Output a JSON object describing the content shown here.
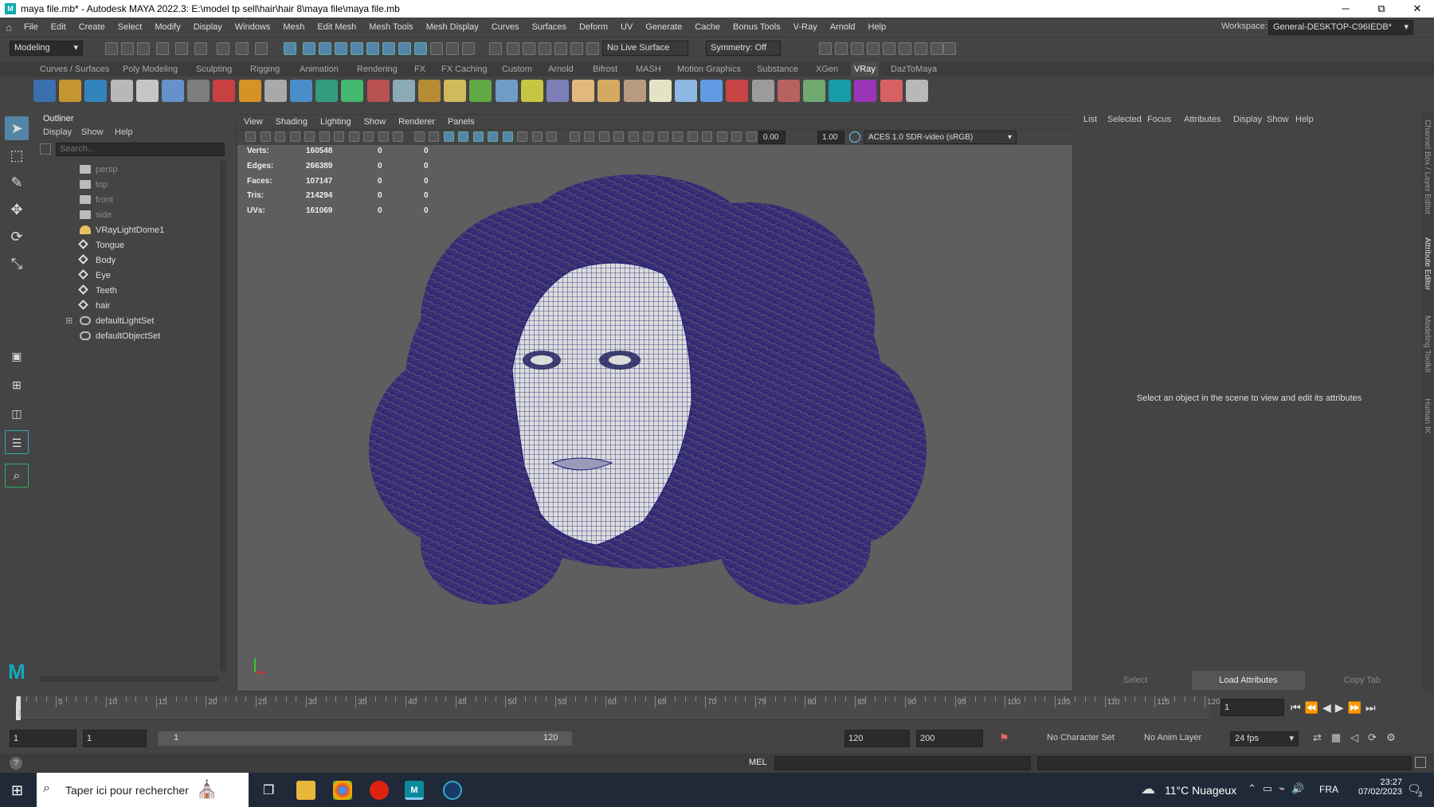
{
  "titlebar": {
    "title": "maya file.mb* - Autodesk MAYA 2022.3: E:\\model tp sell\\hair\\hair 8\\maya file\\maya file.mb",
    "minimize": "─",
    "maximize": "⧉",
    "close": "✕"
  },
  "menubar": {
    "items": [
      "File",
      "Edit",
      "Create",
      "Select",
      "Modify",
      "Display",
      "Windows",
      "Mesh",
      "Edit Mesh",
      "Mesh Tools",
      "Mesh Display",
      "Curves",
      "Surfaces",
      "Deform",
      "UV",
      "Generate",
      "Cache",
      "Bonus Tools",
      "V-Ray",
      "Arnold",
      "Help"
    ],
    "workspace_label": "Workspace:",
    "workspace_value": "General-DESKTOP-C96IEDB*"
  },
  "statusline": {
    "mode": "Modeling",
    "live_surface": "No Live Surface",
    "symmetry": "Symmetry: Off"
  },
  "shelf_tabs": [
    "Curves / Surfaces",
    "Poly Modeling",
    "Sculpting",
    "Rigging",
    "Animation",
    "Rendering",
    "FX",
    "FX Caching",
    "Custom",
    "Arnold",
    "Bifrost",
    "MASH",
    "Motion Graphics",
    "Substance",
    "XGen",
    "VRay",
    "DazToMaya"
  ],
  "shelf_active": "VRay",
  "outliner": {
    "title": "Outliner",
    "menus": [
      "Display",
      "Show",
      "Help"
    ],
    "search_placeholder": "Search...",
    "items": [
      {
        "label": "persp",
        "type": "camera",
        "dim": true
      },
      {
        "label": "top",
        "type": "camera",
        "dim": true
      },
      {
        "label": "front",
        "type": "camera",
        "dim": true
      },
      {
        "label": "side",
        "type": "camera",
        "dim": true
      },
      {
        "label": "VRayLightDome1",
        "type": "light",
        "dim": false
      },
      {
        "label": "Tongue",
        "type": "mesh",
        "dim": false
      },
      {
        "label": "Body",
        "type": "mesh",
        "dim": false
      },
      {
        "label": "Eye",
        "type": "mesh",
        "dim": false
      },
      {
        "label": "Teeth",
        "type": "mesh",
        "dim": false
      },
      {
        "label": "hair",
        "type": "mesh",
        "dim": false
      },
      {
        "label": "defaultLightSet",
        "type": "set",
        "dim": false
      },
      {
        "label": "defaultObjectSet",
        "type": "set",
        "dim": false
      }
    ]
  },
  "viewport": {
    "menus": [
      "View",
      "Shading",
      "Lighting",
      "Show",
      "Renderer",
      "Panels"
    ],
    "exposure": "0.00",
    "gamma": "1.00",
    "colorspace": "ACES 1.0 SDR-video (sRGB)",
    "hud": [
      {
        "label": "Verts:",
        "v1": "160548",
        "v2": "0",
        "v3": "0"
      },
      {
        "label": "Edges:",
        "v1": "266389",
        "v2": "0",
        "v3": "0"
      },
      {
        "label": "Faces:",
        "v1": "107147",
        "v2": "0",
        "v3": "0"
      },
      {
        "label": "Tris:",
        "v1": "214294",
        "v2": "0",
        "v3": "0"
      },
      {
        "label": "UVs:",
        "v1": "161069",
        "v2": "0",
        "v3": "0"
      }
    ],
    "wire_color": "#1a1a7a",
    "face_color": "#d8d8d8"
  },
  "attribute_editor": {
    "menus": [
      "List",
      "Selected",
      "Focus",
      "Attributes",
      "Display",
      "Show",
      "Help"
    ],
    "message": "Select an object in the scene to view and edit its attributes",
    "buttons": [
      "Select",
      "Load Attributes",
      "Copy Tab"
    ]
  },
  "side_tabs": [
    "Channel Box / Layer Editor",
    "Attribute Editor",
    "Modeling Toolkit",
    "Human IK"
  ],
  "timeline": {
    "ticks": [
      "5",
      "10",
      "15",
      "20",
      "25",
      "30",
      "35",
      "40",
      "45",
      "50",
      "55",
      "60",
      "65",
      "70",
      "75",
      "80",
      "85",
      "90",
      "95",
      "100",
      "105",
      "110",
      "115",
      "120"
    ],
    "first": "1",
    "current_frame": "1"
  },
  "range": {
    "start": "1",
    "anim_start": "1",
    "range_start": "1",
    "range_end": "120",
    "anim_end": "120",
    "end": "200",
    "character_set": "No Character Set",
    "anim_layer": "No Anim Layer",
    "fps": "24 fps"
  },
  "cmdline": {
    "lang": "MEL"
  },
  "taskbar": {
    "search_placeholder": "Taper ici pour rechercher",
    "weather": "11°C  Nuageux",
    "lang": "FRA",
    "time": "23:27",
    "date": "07/02/2023",
    "notif": "3"
  }
}
